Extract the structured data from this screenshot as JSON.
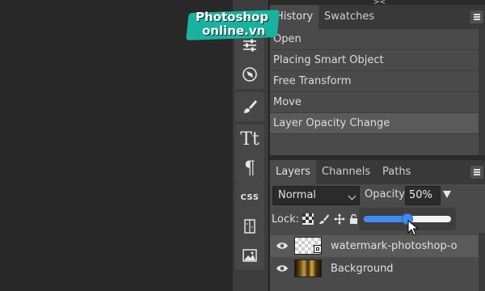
{
  "logo": {
    "line1": "Photoshop",
    "line2": "online.vn"
  },
  "top_arrows": "><",
  "history_panel": {
    "tabs": [
      {
        "label": "History",
        "active": true
      },
      {
        "label": "Swatches",
        "active": false
      }
    ],
    "items": [
      {
        "label": "Open"
      },
      {
        "label": "Placing Smart Object"
      },
      {
        "label": "Free Transform"
      },
      {
        "label": "Move"
      },
      {
        "label": "Layer Opacity Change",
        "current": true
      }
    ]
  },
  "layers_panel": {
    "tabs": [
      {
        "label": "Layers",
        "active": true
      },
      {
        "label": "Channels",
        "active": false
      },
      {
        "label": "Paths",
        "active": false
      }
    ],
    "blend_mode": "Normal",
    "opacity_label": "Opacity:",
    "opacity_value": "50%",
    "opacity_fraction": 0.5,
    "lock_label": "Lock:",
    "layers": [
      {
        "name": "watermark-photoshop-o",
        "thumb": "checker",
        "smart_object": true,
        "selected": true
      },
      {
        "name": "Background",
        "thumb": "photo",
        "smart_object": false,
        "selected": false
      }
    ]
  },
  "toolbar": {
    "icons": [
      "adjustments-icon",
      "compass-icon",
      "brush-icon",
      "type-icon",
      "paragraph-icon",
      "css-icon",
      "properties-icon",
      "image-icon"
    ],
    "type_glyph": "Tt",
    "paragraph_glyph": "¶",
    "css_label": "CSS"
  },
  "colors": {
    "accent": "#3d8df0",
    "logo_teal": "#19b2a0",
    "panel": "#4a4a4a",
    "canvas": "#282828"
  }
}
